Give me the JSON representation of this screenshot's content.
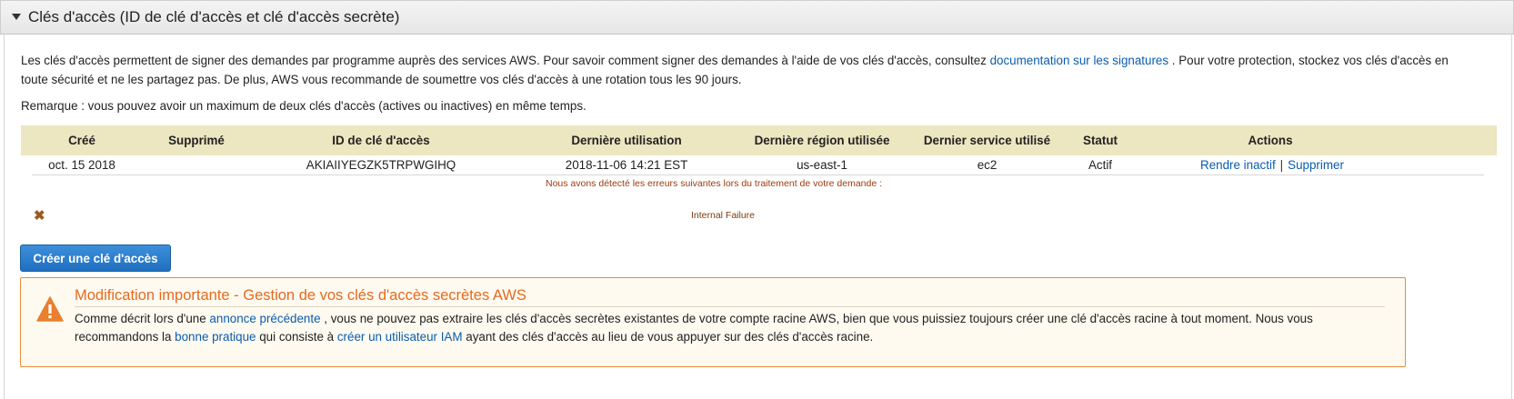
{
  "panel": {
    "title": "Clés d'accès (ID de clé d'accès et clé d'accès secrète)"
  },
  "description": {
    "part1": "Les clés d'accès permettent de signer des demandes par programme auprès des services AWS. Pour savoir comment signer des demandes à l'aide de vos clés d'accès, consultez ",
    "link": "documentation sur les signatures",
    "part2": " . Pour votre protection, stockez vos clés d'accès en toute sécurité et ne les partagez pas. De plus, AWS vous recommande de soumettre vos clés d'accès à une rotation tous les 90 jours."
  },
  "remark": "Remarque : vous pouvez avoir un maximum de deux clés d'accès (actives ou inactives) en même temps.",
  "table": {
    "headers": {
      "created": "Créé",
      "deleted": "Supprimé",
      "key_id": "ID de clé d'accès",
      "last_used": "Dernière utilisation",
      "last_region": "Dernière région utilisée",
      "last_service": "Dernier service utilisé",
      "status": "Statut",
      "actions": "Actions"
    },
    "rows": [
      {
        "created": "oct. 15 2018",
        "deleted": "",
        "key_id": "AKIAIIYEGZK5TRPWGIHQ",
        "last_used": "2018-11-06 14:21 EST",
        "last_region": "us-east-1",
        "last_service": "ec2",
        "status": "Actif",
        "action_deactivate": "Rendre inactif",
        "action_separator": "|",
        "action_delete": "Supprimer"
      }
    ]
  },
  "error": {
    "heading": "Nous avons détecté les erreurs suivantes lors du traitement de votre demande :",
    "icon": "close-x-icon",
    "message": "Internal Failure"
  },
  "create_button": "Créer une clé d'accès",
  "alert": {
    "icon": "warning-icon",
    "title": "Modification importante - Gestion de vos clés d'accès secrètes AWS",
    "text1": "Comme décrit lors d'une ",
    "link1": "annonce précédente",
    "text2": " , vous ne pouvez pas extraire les clés d'accès secrètes existantes de votre compte racine AWS, bien que vous puissiez toujours créer une clé d'accès racine à tout moment. Nous vous recommandons la ",
    "link2": "bonne pratique",
    "text3": " qui consiste à ",
    "link3": "créer un utilisateur IAM",
    "text4": " ayant des clés d'accès au lieu de vous appuyer sur des clés d'accès racine."
  },
  "colors": {
    "link": "#0b5cad",
    "table_header_bg": "#ece6c1",
    "alert_border": "#ee8a3c",
    "alert_title": "#e66a1e",
    "button_bg": "#2a7ccf"
  }
}
